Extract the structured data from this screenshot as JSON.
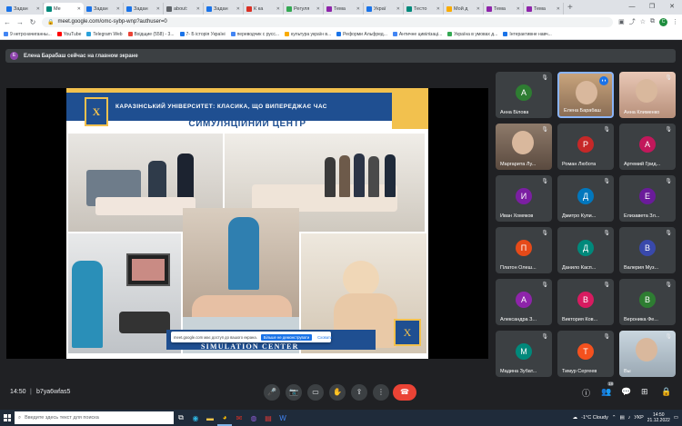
{
  "browser": {
    "tabs": [
      {
        "title": "Задан",
        "color": "#1a73e8"
      },
      {
        "title": "Me",
        "color": "#00897b",
        "active": true
      },
      {
        "title": "Задан",
        "color": "#1a73e8"
      },
      {
        "title": "Задан",
        "color": "#1a73e8"
      },
      {
        "title": "about:",
        "color": "#5f6368"
      },
      {
        "title": "Задан",
        "color": "#1a73e8"
      },
      {
        "title": "К ка",
        "color": "#d93025"
      },
      {
        "title": "Регуля",
        "color": "#34a853"
      },
      {
        "title": "Тема",
        "color": "#8e24aa"
      },
      {
        "title": "Украї",
        "color": "#1a73e8"
      },
      {
        "title": "Тесто",
        "color": "#00897b"
      },
      {
        "title": "Мой д",
        "color": "#f9ab00"
      },
      {
        "title": "Тема",
        "color": "#8e24aa"
      },
      {
        "title": "Тема",
        "color": "#8e24aa"
      }
    ],
    "new_tab": "+",
    "url": "meet.google.com/omc-sybp-wnp?authuser=0",
    "profile_initial": "C",
    "bookmarks": [
      {
        "label": "9 нетрсначиганны...",
        "color": "#4285f4"
      },
      {
        "label": "YouTube",
        "color": "#ff0000"
      },
      {
        "label": "Telegram Web",
        "color": "#2aa1da"
      },
      {
        "label": "Вхідщие (558) - 3...",
        "color": "#ea4335"
      },
      {
        "label": "7- Б історія Україні",
        "color": "#1a73e8"
      },
      {
        "label": "переводчик с русс...",
        "color": "#4285f4"
      },
      {
        "label": "культура україн в...",
        "color": "#f9ab00"
      },
      {
        "label": "Реформи Альфред...",
        "color": "#1a73e8"
      },
      {
        "label": "Античне цивілізаці...",
        "color": "#4285f4"
      },
      {
        "label": "Україна в умовах д...",
        "color": "#34a853"
      },
      {
        "label": "Інтерактивне навч...",
        "color": "#1a73e8"
      }
    ]
  },
  "meet": {
    "notification": {
      "initial": "E",
      "text": "Елена Барабаш сейчас на главном экране"
    },
    "slide": {
      "university": "КАРАЗІНСЬКИЙ УНІВЕРСИТЕТ: КЛАСИКА, ЩО ВИПЕРЕДЖАЄ ЧАС",
      "title": "СИМУЛЯЦІЙНИЙ ЦЕНТР",
      "banner": "SIMULATION CENTER",
      "crest": "Х"
    },
    "share_popup": {
      "text": "meet.google.com має доступ до вашого екрана.",
      "primary": "Більше не демонструвати",
      "secondary": "Сховати"
    },
    "participants": [
      {
        "name": "Анна Білова",
        "initial": "А",
        "color": "#2e7d32"
      },
      {
        "name": "Елена Барабаш",
        "initial": "",
        "photo": "1",
        "speaking": true
      },
      {
        "name": "Анна Клименко",
        "initial": "",
        "photo": "2"
      },
      {
        "name": "Маргарита Лу...",
        "initial": "",
        "photo": "3"
      },
      {
        "name": "Роман Любота",
        "initial": "Р",
        "color": "#c62828"
      },
      {
        "name": "Артемий Грид...",
        "initial": "А",
        "color": "#c2185b"
      },
      {
        "name": "Иван Хомяков",
        "initial": "И",
        "color": "#7b1fa2"
      },
      {
        "name": "Дмитро Купи...",
        "initial": "Д",
        "color": "#0277bd"
      },
      {
        "name": "Елизавета Зл...",
        "initial": "Е",
        "color": "#6a1b9a"
      },
      {
        "name": "Платон Олеш...",
        "initial": "П",
        "color": "#e64a19"
      },
      {
        "name": "Данило Касп...",
        "initial": "Д",
        "color": "#00897b"
      },
      {
        "name": "Валерия Муз...",
        "initial": "В",
        "color": "#3949ab"
      },
      {
        "name": "Александра З...",
        "initial": "А",
        "color": "#8e24aa"
      },
      {
        "name": "Виктория Ков...",
        "initial": "В",
        "color": "#d81b60"
      },
      {
        "name": "Вероника Фе...",
        "initial": "В",
        "color": "#2e7d32"
      },
      {
        "name": "Мадина Зубат...",
        "initial": "М",
        "color": "#00897b"
      },
      {
        "name": "Тимур Сергеев",
        "initial": "Т",
        "color": "#f4511e"
      },
      {
        "name": "Вы",
        "initial": "",
        "photo": "4"
      }
    ],
    "time": "14:50",
    "separator": "|",
    "code": "b7ya6wfas5",
    "controls": {
      "mic": "🎤",
      "camera": "📷",
      "captions": "▭",
      "hand": "✋",
      "present": "⇪",
      "more": "⋮",
      "end": "☎"
    },
    "right_controls": {
      "info": "ⓘ",
      "people": "👥",
      "chat": "💬",
      "activities": "⊞",
      "lock": "🔒"
    },
    "people_count": "18"
  },
  "taskbar": {
    "search_placeholder": "Введите здесь текст для поиска",
    "weather": "-1°C  Cloudy",
    "lang": "УКР",
    "time": "14:50",
    "date": "21.12.2022"
  }
}
